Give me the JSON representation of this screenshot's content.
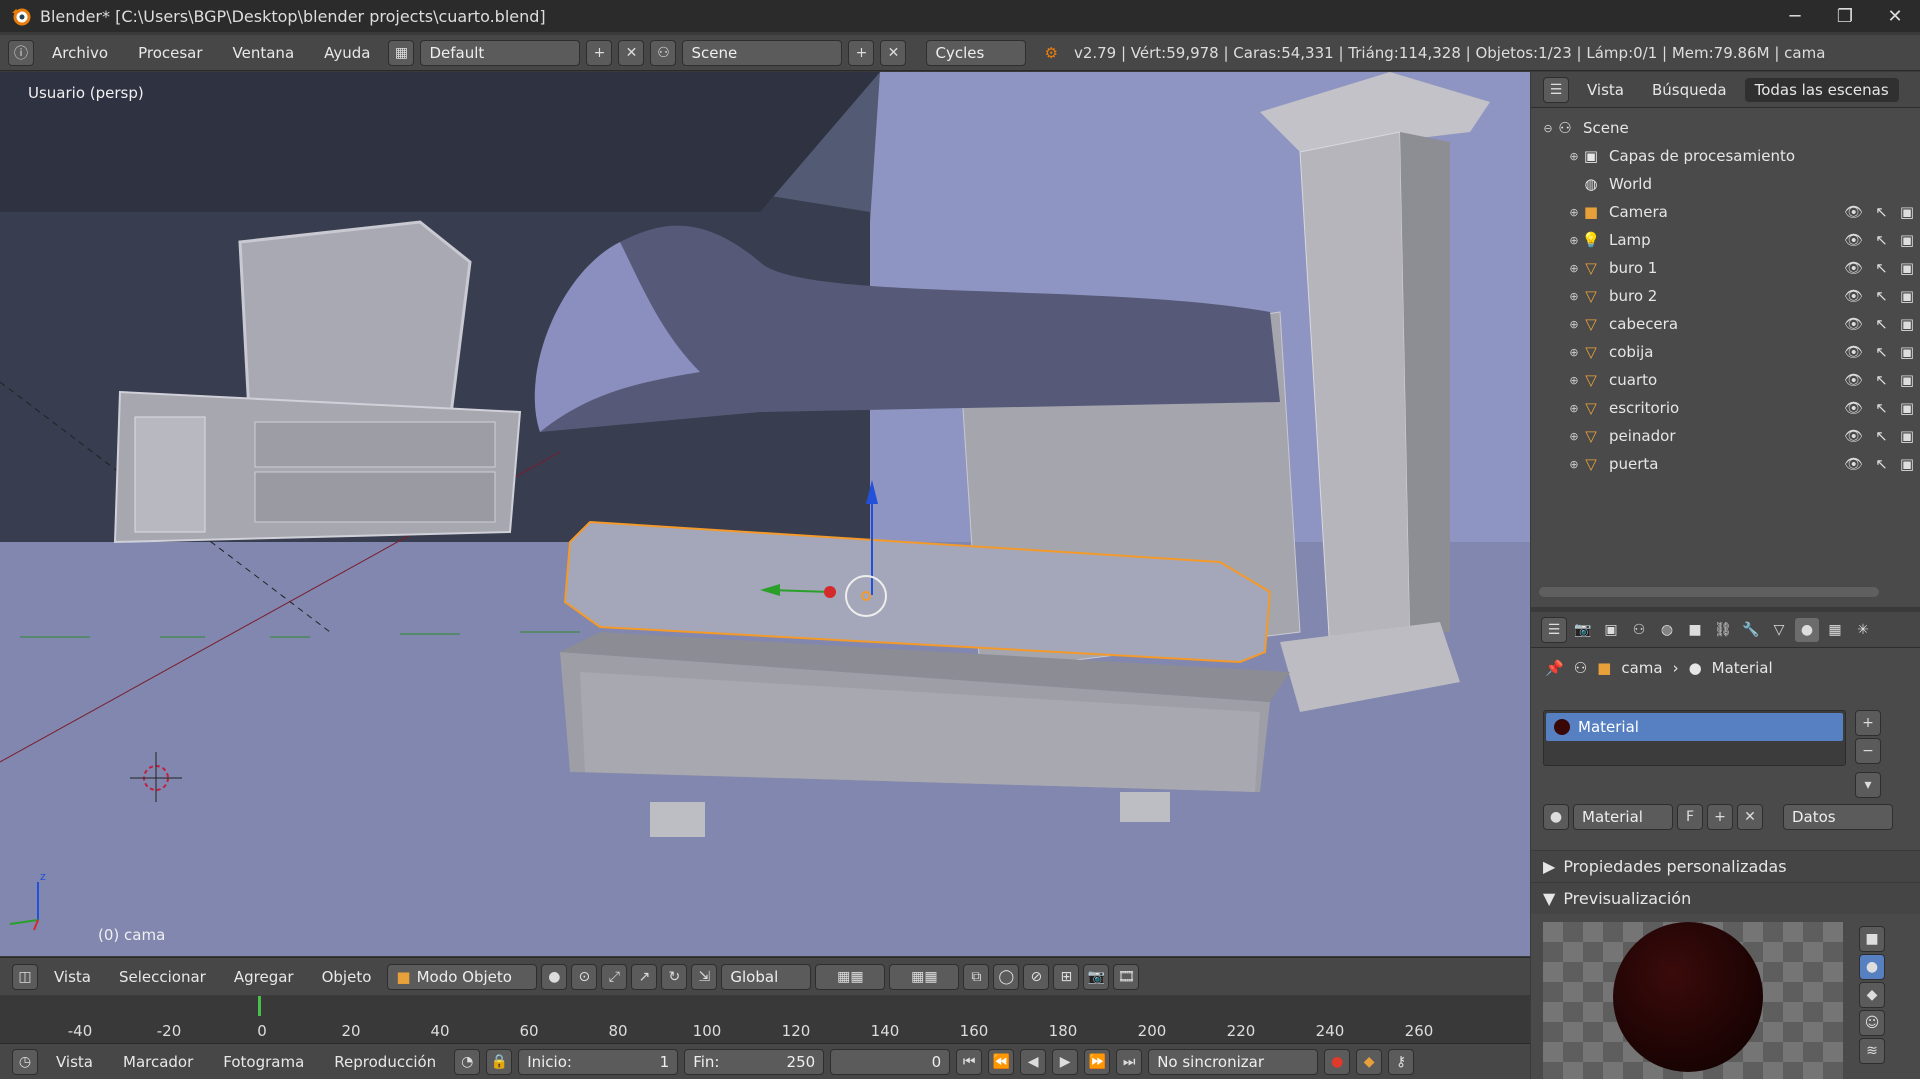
{
  "window": {
    "title": "Blender* [C:\\Users\\BGP\\Desktop\\blender projects\\cuarto.blend]",
    "controls": [
      "─",
      "❐",
      "✕"
    ]
  },
  "info": {
    "menus": [
      "Archivo",
      "Procesar",
      "Ventana",
      "Ayuda"
    ],
    "layout": "Default",
    "scene": "Scene",
    "engine": "Cycles",
    "stats": "v2.79 | Vért:59,978 | Caras:54,331 | Triáng:114,328 | Objetos:1/23 | Lámp:0/1 | Mem:79.86M | cama"
  },
  "viewport": {
    "label": "Usuario (persp)",
    "object_label": "(0) cama",
    "bg_color": "#7e84a6"
  },
  "header3d": {
    "menus": [
      "Vista",
      "Seleccionar",
      "Agregar",
      "Objeto"
    ],
    "mode": "Modo Objeto",
    "orientation": "Global"
  },
  "timeline": {
    "ticks": [
      "-40",
      "-20",
      "0",
      "20",
      "40",
      "60",
      "80",
      "100",
      "120",
      "140",
      "160",
      "180",
      "200",
      "220",
      "240",
      "260"
    ],
    "menus": [
      "Vista",
      "Marcador",
      "Fotograma",
      "Reproducción"
    ],
    "start_label": "Inicio:",
    "start": "1",
    "end_label": "Fin:",
    "end": "250",
    "current": "0",
    "sync": "No sincronizar"
  },
  "outliner": {
    "tabs": [
      "Vista",
      "Búsqueda",
      "Todas las escenas"
    ],
    "scene": "Scene",
    "items": [
      {
        "label": "Capas de procesamiento",
        "icon": "render-layers-icon"
      },
      {
        "label": "World",
        "icon": "world-icon"
      },
      {
        "label": "Camera",
        "icon": "camera-icon"
      },
      {
        "label": "Lamp",
        "icon": "lamp-icon"
      },
      {
        "label": "buro 1",
        "icon": "mesh-icon"
      },
      {
        "label": "buro 2",
        "icon": "mesh-icon"
      },
      {
        "label": "cabecera",
        "icon": "mesh-icon"
      },
      {
        "label": "cobija",
        "icon": "mesh-icon"
      },
      {
        "label": "cuarto",
        "icon": "mesh-icon"
      },
      {
        "label": "escritorio",
        "icon": "mesh-icon"
      },
      {
        "label": "peinador",
        "icon": "mesh-icon"
      },
      {
        "label": "puerta",
        "icon": "mesh-icon"
      }
    ]
  },
  "properties": {
    "crumb_object": "cama",
    "crumb_material": "Material",
    "slot": "Material",
    "datablock": "Material",
    "fake_user": "F",
    "link": "Datos",
    "panels": [
      "Propiedades personalizadas",
      "Previsualización"
    ],
    "material_color": "#2a0606"
  }
}
